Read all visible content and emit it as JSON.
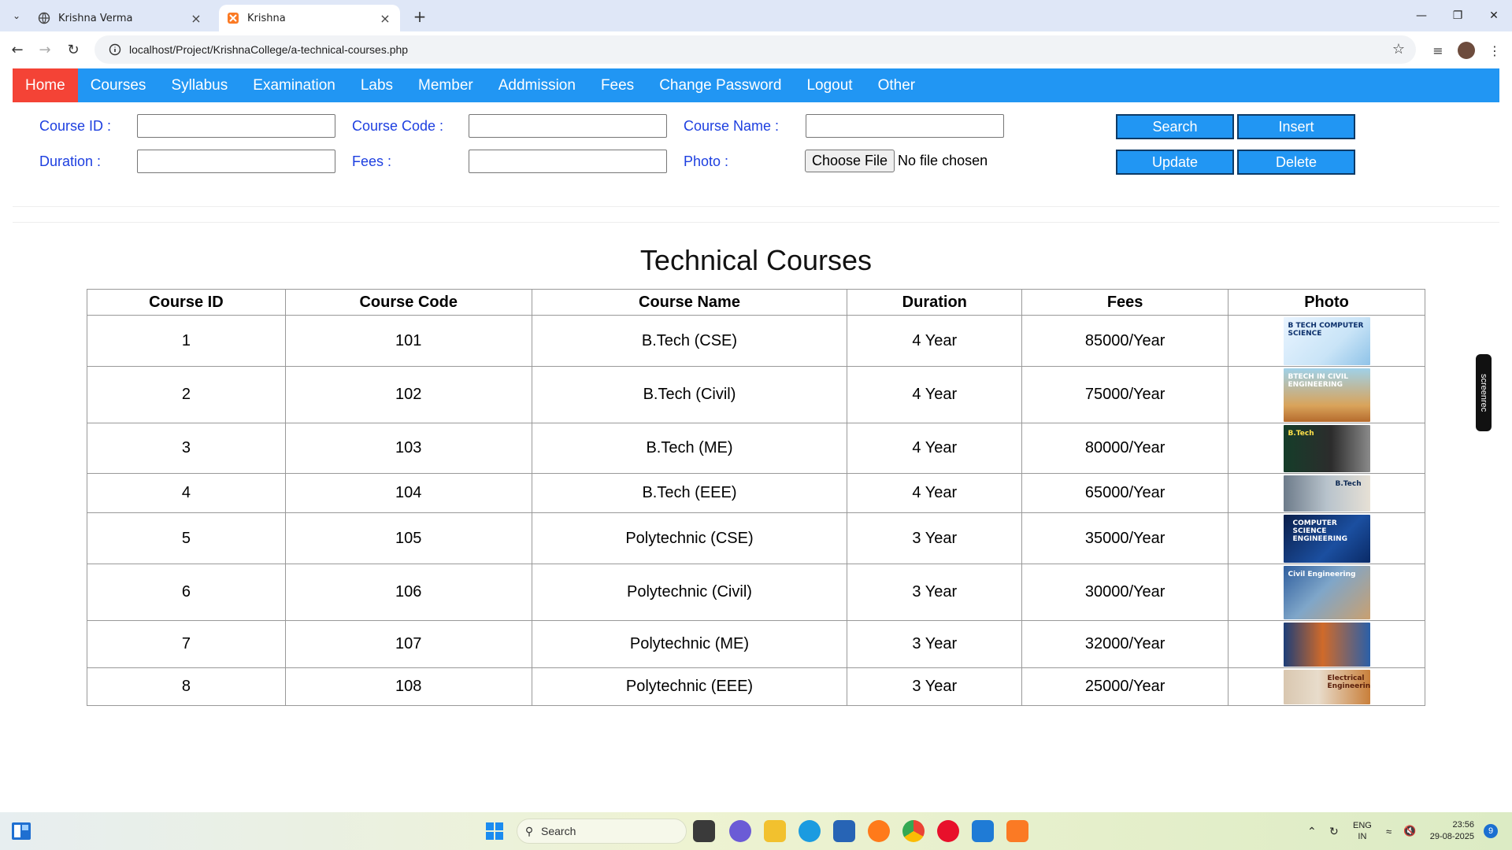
{
  "browser": {
    "tabs": [
      {
        "title": "Krishna Verma",
        "active": false
      },
      {
        "title": "Krishna",
        "active": true
      }
    ],
    "url": "localhost/Project/KrishnaCollege/a-technical-courses.php"
  },
  "nav": {
    "items": [
      "Home",
      "Courses",
      "Syllabus",
      "Examination",
      "Labs",
      "Member",
      "Addmission",
      "Fees",
      "Change Password",
      "Logout",
      "Other"
    ],
    "active_color": "#f44336",
    "bar_color": "#2196f3"
  },
  "form": {
    "course_id_label": "Course ID :",
    "course_code_label": "Course Code :",
    "course_name_label": "Course Name :",
    "duration_label": "Duration :",
    "fees_label": "Fees :",
    "photo_label": "Photo :",
    "choose_file": "Choose File",
    "no_file": "No file chosen",
    "buttons": {
      "search": "Search",
      "insert": "Insert",
      "update": "Update",
      "delete": "Delete"
    },
    "label_color": "#1d3fe0"
  },
  "page_title": "Technical Courses",
  "table": {
    "headers": [
      "Course ID",
      "Course Code",
      "Course Name",
      "Duration",
      "Fees",
      "Photo"
    ],
    "rows": [
      {
        "id": "1",
        "code": "101",
        "name": "B.Tech (CSE)",
        "duration": "4 Year",
        "fees": "85000/Year",
        "photo": "B TECH COMPUTER SCIENCE"
      },
      {
        "id": "2",
        "code": "102",
        "name": "B.Tech (Civil)",
        "duration": "4 Year",
        "fees": "75000/Year",
        "photo": "BTECH IN CIVIL ENGINEERING"
      },
      {
        "id": "3",
        "code": "103",
        "name": "B.Tech (ME)",
        "duration": "4 Year",
        "fees": "80000/Year",
        "photo": "B.Tech"
      },
      {
        "id": "4",
        "code": "104",
        "name": "B.Tech (EEE)",
        "duration": "4 Year",
        "fees": "65000/Year",
        "photo": "B.Tech"
      },
      {
        "id": "5",
        "code": "105",
        "name": "Polytechnic (CSE)",
        "duration": "3 Year",
        "fees": "35000/Year",
        "photo": "COMPUTER SCIENCE ENGINEERING"
      },
      {
        "id": "6",
        "code": "106",
        "name": "Polytechnic (Civil)",
        "duration": "3 Year",
        "fees": "30000/Year",
        "photo": "Civil Engineering"
      },
      {
        "id": "7",
        "code": "107",
        "name": "Polytechnic (ME)",
        "duration": "3 Year",
        "fees": "32000/Year",
        "photo": ""
      },
      {
        "id": "8",
        "code": "108",
        "name": "Polytechnic (EEE)",
        "duration": "3 Year",
        "fees": "25000/Year",
        "photo": "Electrical Engineering"
      }
    ]
  },
  "overlay": {
    "screenrec": "screenrec"
  },
  "taskbar": {
    "search_placeholder": "Search",
    "lang_top": "ENG",
    "lang_bottom": "IN",
    "time": "23:56",
    "date": "29-08-2025",
    "notifications": "9"
  }
}
